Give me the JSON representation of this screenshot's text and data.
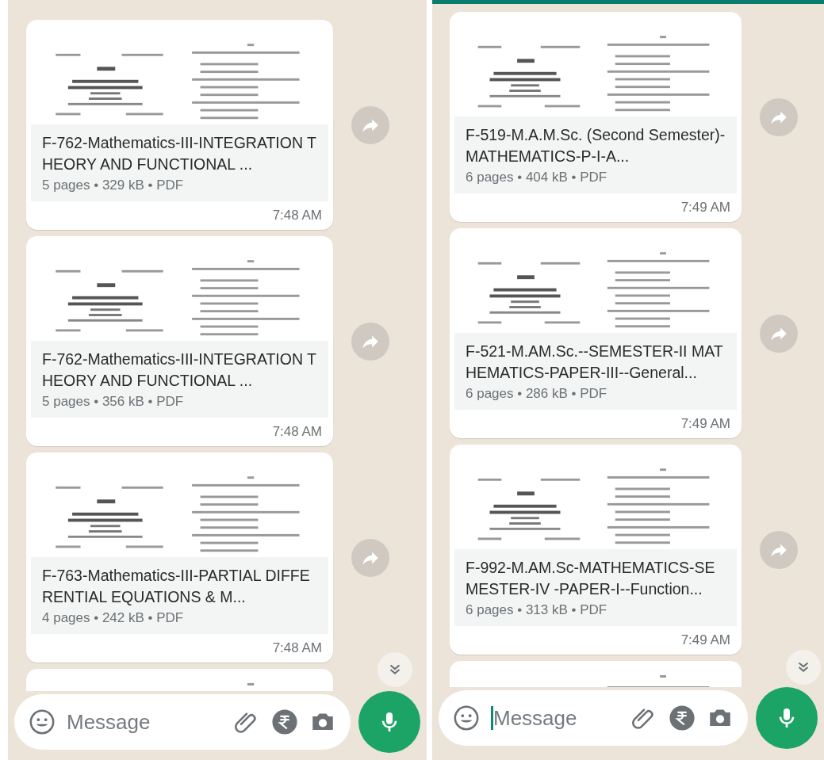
{
  "panels": [
    {
      "messages": [
        {
          "kind": "document",
          "title": "F-762-Mathematics-III-INTEGRATION THEORY AND FUNCTIONAL ...",
          "meta": "5 pages • 329 kB • PDF",
          "time": "7:48 AM"
        },
        {
          "kind": "document",
          "title": "F-762-Mathematics-III-INTEGRATION THEORY AND FUNCTIONAL ...",
          "meta": "5 pages • 356 kB • PDF",
          "time": "7:48 AM"
        },
        {
          "kind": "document",
          "title": "F-763-Mathematics-III-PARTIAL DIFFERENTIAL EQUATIONS & M...",
          "meta": "4 pages • 242 kB • PDF",
          "time": "7:48 AM"
        },
        {
          "kind": "preview"
        }
      ],
      "composer": {
        "placeholder": "Message",
        "focused": false
      }
    },
    {
      "messages": [
        {
          "kind": "document",
          "title": "F-519-M.A.M.Sc. (Second Semester)-MATHEMATICS-P-I-A...",
          "meta": "6 pages • 404 kB • PDF",
          "time": "7:49 AM"
        },
        {
          "kind": "document",
          "title": "F-521-M.AM.Sc.--SEMESTER-II MATHEMATICS-PAPER-III--General...",
          "meta": "6 pages • 286 kB • PDF",
          "time": "7:49 AM"
        },
        {
          "kind": "document",
          "title": "F-992-M.AM.Sc-MATHEMATICS-SEMESTER-IV -PAPER-I--Function...",
          "meta": "6 pages • 313 kB • PDF",
          "time": "7:49 AM"
        },
        {
          "kind": "preview"
        }
      ],
      "composer": {
        "placeholder": "Message",
        "focused": true
      }
    }
  ]
}
